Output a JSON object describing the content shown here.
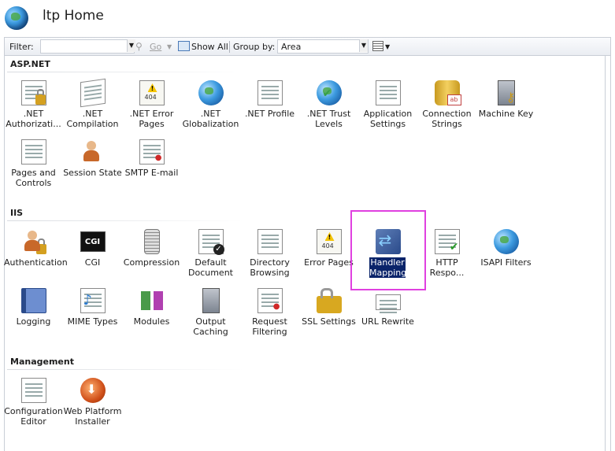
{
  "window": {
    "title": "ltp Home"
  },
  "toolbar": {
    "filter_label": "Filter:",
    "filter_value": "",
    "go_label": "Go",
    "show_all_label": "Show All",
    "group_by_label": "Group by:",
    "group_by_value": "Area"
  },
  "groups": [
    {
      "name": "ASP.NET",
      "items": [
        {
          "label": ".NET Authorizati...",
          "icon": "dotnet-authorization-icon"
        },
        {
          "label": ".NET Compilation",
          "icon": "dotnet-compilation-icon"
        },
        {
          "label": ".NET Error Pages",
          "icon": "dotnet-error-pages-icon"
        },
        {
          "label": ".NET Globalization",
          "icon": "dotnet-globalization-icon"
        },
        {
          "label": ".NET Profile",
          "icon": "dotnet-profile-icon"
        },
        {
          "label": ".NET Trust Levels",
          "icon": "dotnet-trust-levels-icon"
        },
        {
          "label": "Application Settings",
          "icon": "application-settings-icon"
        },
        {
          "label": "Connection Strings",
          "icon": "connection-strings-icon"
        },
        {
          "label": "Machine Key",
          "icon": "machine-key-icon"
        },
        {
          "label": "Pages and Controls",
          "icon": "pages-and-controls-icon"
        },
        {
          "label": "Session State",
          "icon": "session-state-icon"
        },
        {
          "label": "SMTP E-mail",
          "icon": "smtp-email-icon"
        }
      ]
    },
    {
      "name": "IIS",
      "items": [
        {
          "label": "Authentication",
          "icon": "authentication-icon"
        },
        {
          "label": "CGI",
          "icon": "cgi-icon"
        },
        {
          "label": "Compression",
          "icon": "compression-icon"
        },
        {
          "label": "Default Document",
          "icon": "default-document-icon"
        },
        {
          "label": "Directory Browsing",
          "icon": "directory-browsing-icon"
        },
        {
          "label": "Error Pages",
          "icon": "error-pages-icon"
        },
        {
          "label": "Handler Mappings",
          "icon": "handler-mappings-icon",
          "selected": true
        },
        {
          "label": "HTTP Respo...",
          "icon": "http-response-headers-icon"
        },
        {
          "label": "ISAPI Filters",
          "icon": "isapi-filters-icon"
        },
        {
          "label": "Logging",
          "icon": "logging-icon"
        },
        {
          "label": "MIME Types",
          "icon": "mime-types-icon"
        },
        {
          "label": "Modules",
          "icon": "modules-icon"
        },
        {
          "label": "Output Caching",
          "icon": "output-caching-icon"
        },
        {
          "label": "Request Filtering",
          "icon": "request-filtering-icon"
        },
        {
          "label": "SSL Settings",
          "icon": "ssl-settings-icon"
        },
        {
          "label": "URL Rewrite",
          "icon": "url-rewrite-icon"
        }
      ]
    },
    {
      "name": "Management",
      "items": [
        {
          "label": "Configuration Editor",
          "icon": "configuration-editor-icon"
        },
        {
          "label": "Web Platform Installer",
          "icon": "web-platform-installer-icon"
        }
      ]
    }
  ],
  "colors": {
    "highlight_box": "#e040e0",
    "selection": "#0a246a"
  }
}
